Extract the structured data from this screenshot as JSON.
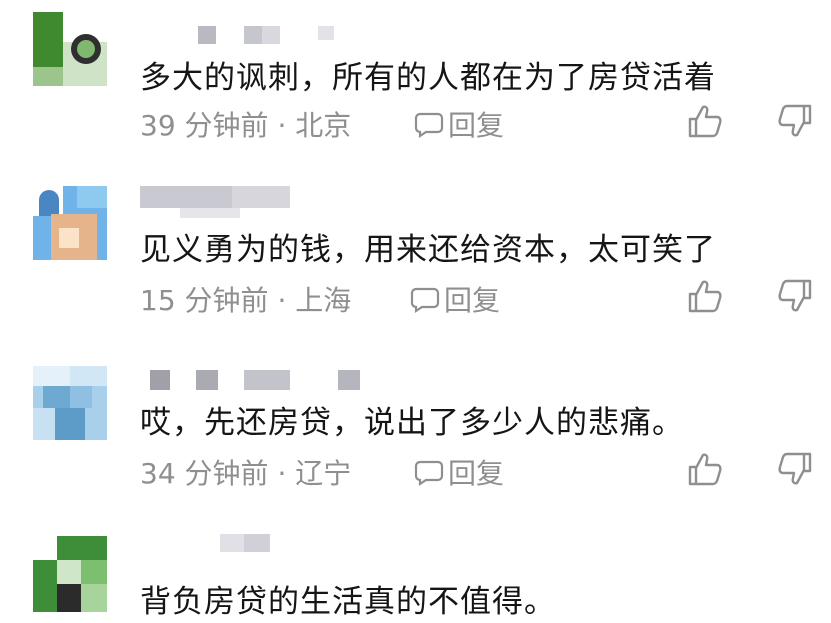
{
  "comments": [
    {
      "text": "多大的讽刺，所有的人都在为了房贷活着",
      "time": "39 分钟前",
      "location": "北京",
      "reply_label": "回复"
    },
    {
      "text": "见义勇为的钱，用来还给资本，太可笑了",
      "time": "15 分钟前",
      "location": "上海",
      "reply_label": "回复"
    },
    {
      "text": "哎，先还房贷，说出了多少人的悲痛。",
      "time": "34 分钟前",
      "location": "辽宁",
      "reply_label": "回复"
    },
    {
      "text": "背负房贷的生活真的不值得。"
    }
  ],
  "meta_separator": "·",
  "colors": {
    "text": "#151515",
    "meta": "#8f8f8f"
  },
  "icons": {
    "reply": "comment-bubble-icon",
    "like": "thumbs-up-icon",
    "dislike": "thumbs-down-icon"
  }
}
